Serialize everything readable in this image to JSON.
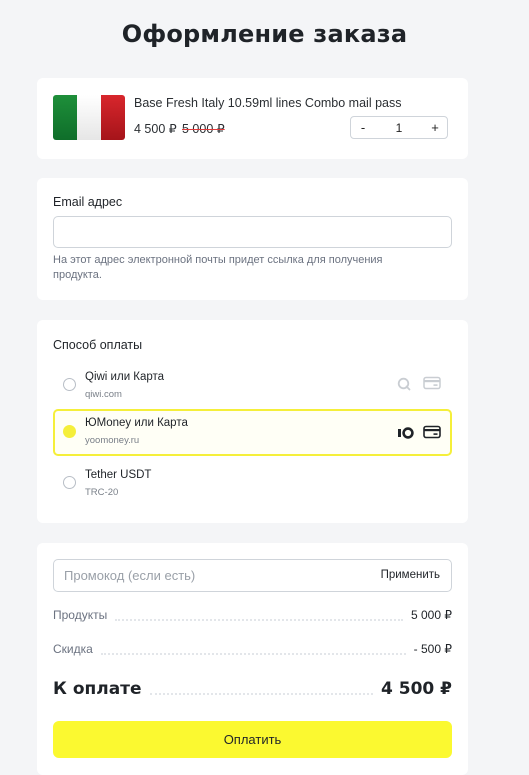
{
  "header": {
    "title": "Оформление заказа"
  },
  "product": {
    "name": "Base Fresh Italy 10.59ml lines Combo mail pass",
    "price": "4 500 ₽",
    "old_price": "5 000 ₽",
    "quantity": "1",
    "minus": "-",
    "plus": "+",
    "flag_colors": [
      "#1e8f3a",
      "#ffffff",
      "#d8262c"
    ]
  },
  "email": {
    "label": "Email адрес",
    "value": "",
    "hint": "На этот адрес электронной почты придет ссылка для получения продукта."
  },
  "payment": {
    "title": "Способ оплаты",
    "options": [
      {
        "name": "Qiwi или Карта",
        "sub": "qiwi.com",
        "selected": false,
        "icons": [
          "qiwi-icon",
          "card-icon"
        ]
      },
      {
        "name": "ЮMoney или Карта",
        "sub": "yoomoney.ru",
        "selected": true,
        "icons": [
          "yoomoney-icon",
          "card-icon"
        ]
      },
      {
        "name": "Tether USDT",
        "sub": "TRC-20",
        "selected": false,
        "icons": []
      }
    ],
    "accent": "#f5ef3a"
  },
  "summary": {
    "promo_placeholder": "Промокод (если есть)",
    "promo_apply": "Применить",
    "products_label": "Продукты",
    "products_amount": "5 000 ₽",
    "discount_label": "Скидка",
    "discount_amount": "- 500 ₽",
    "total_label": "К оплате",
    "total_amount": "4 500 ₽",
    "pay_button": "Оплатить",
    "button_color": "#fbf930"
  }
}
